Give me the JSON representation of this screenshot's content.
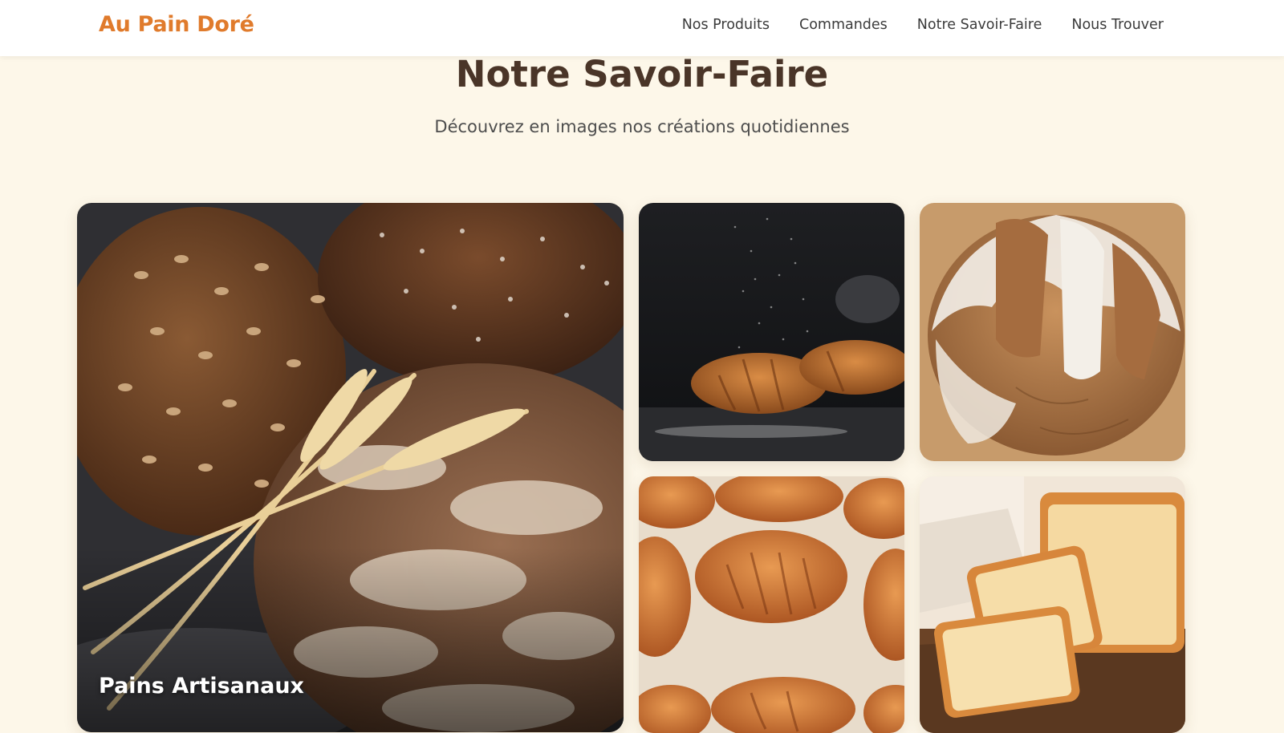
{
  "brand": {
    "name": "Au Pain Doré"
  },
  "nav": {
    "items": [
      {
        "label": "Nos Produits"
      },
      {
        "label": "Commandes"
      },
      {
        "label": "Notre Savoir-Faire"
      },
      {
        "label": "Nous Trouver"
      }
    ]
  },
  "hero": {
    "title": "Notre Savoir-Faire",
    "subtitle": "Découvrez en images nos créations quotidiennes"
  },
  "gallery": {
    "featured": {
      "caption": "Pains Artisanaux"
    }
  },
  "colors": {
    "accent": "#e07b2c",
    "heading": "#4a3528",
    "background": "#fdf7e9"
  }
}
